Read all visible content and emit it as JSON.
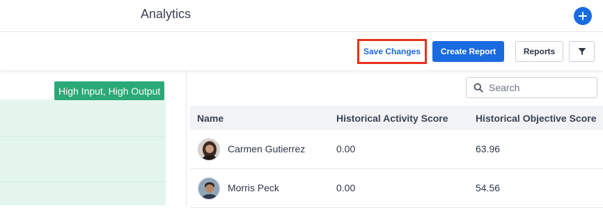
{
  "header": {
    "title": "Analytics"
  },
  "toolbar": {
    "save_label": "Save Changes",
    "create_label": "Create Report",
    "reports_label": "Reports"
  },
  "quadrant": {
    "label": "High Input, High Output"
  },
  "search": {
    "placeholder": "Search"
  },
  "table": {
    "columns": [
      "Name",
      "Historical Activity Score",
      "Historical Objective Score"
    ],
    "rows": [
      {
        "name": "Carmen Gutierrez",
        "activity": "0.00",
        "objective": "63.96"
      },
      {
        "name": "Morris Peck",
        "activity": "0.00",
        "objective": "54.56"
      }
    ]
  },
  "colors": {
    "accent": "#1a6ae0",
    "quadrant": "#2aa977",
    "highlight": "#e8301a"
  }
}
